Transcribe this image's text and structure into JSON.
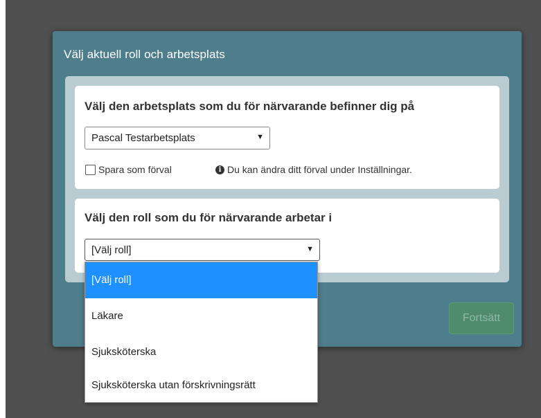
{
  "modal": {
    "title": "Välj aktuell roll och arbetsplats",
    "continue_label": "Fortsätt"
  },
  "workplace": {
    "heading": "Välj den arbetsplats som du för närvarande befinner dig på",
    "selected": "Pascal Testarbetsplats",
    "checkbox_label": "Spara som förval",
    "checkbox_checked": false,
    "info_text": "Du kan ändra ditt förval under Inställningar."
  },
  "role": {
    "heading": "Välj den roll som du för närvarande arbetar i",
    "selected": "[Välj roll]",
    "options": [
      "[Välj roll]",
      "Läkare",
      "Sjuksköterska",
      "Sjuksköterska utan förskrivningsrätt"
    ]
  },
  "icons": {
    "dropdown_arrow": "▼",
    "info": "i"
  },
  "colors": {
    "modal_bg": "#4e7d8b",
    "highlight": "#1e90ff",
    "continue_button": "#4f8c6c"
  }
}
